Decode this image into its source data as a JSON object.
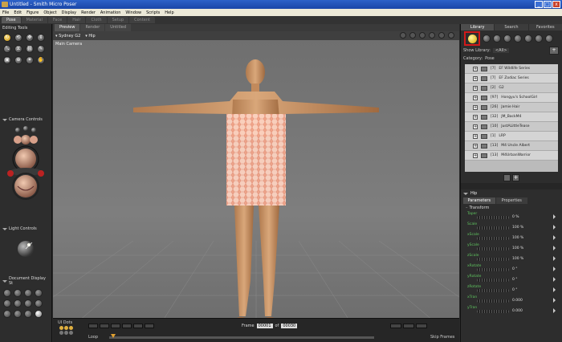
{
  "window": {
    "title": "Untitled - Smith Micro Poser"
  },
  "menu": [
    "File",
    "Edit",
    "Figure",
    "Object",
    "Display",
    "Render",
    "Animation",
    "Window",
    "Scripts",
    "Help"
  ],
  "room_tabs": [
    {
      "label": "Pose",
      "active": true
    },
    {
      "label": "Material",
      "active": false
    },
    {
      "label": "Face",
      "active": false
    },
    {
      "label": "Hair",
      "active": false
    },
    {
      "label": "Cloth",
      "active": false
    },
    {
      "label": "Setup",
      "active": false
    },
    {
      "label": "Content",
      "active": false
    }
  ],
  "left": {
    "editing_tools_title": "Editing Tools",
    "camera_controls_title": "Camera Controls",
    "light_controls_title": "Light Controls",
    "document_display_title": "Document Display St"
  },
  "viewport": {
    "tabs": [
      {
        "label": "Preview",
        "active": true
      },
      {
        "label": "Render",
        "active": false
      },
      {
        "label": "Untitled",
        "active": false
      }
    ],
    "figure_selector": "Sydney G2",
    "actor_selector": "Hip",
    "camera_label": "Main Camera"
  },
  "timeline": {
    "ui_dots_label": "UI Dots",
    "loop_label": "Loop",
    "frame_label": "Frame",
    "frame_value": "00001",
    "of_label": "of",
    "total_frames": "00030",
    "skip_frames_label": "Skip Frames"
  },
  "library": {
    "tabs": [
      {
        "label": "Library",
        "active": true
      },
      {
        "label": "Search",
        "active": false
      },
      {
        "label": "Favorites",
        "active": false
      }
    ],
    "show_library_label": "Show Library:",
    "show_library_value": "<All>",
    "category_label": "Category:",
    "category_value": "Pose",
    "items": [
      {
        "count": "[7]",
        "name": "EF Wildlife Series"
      },
      {
        "count": "[7]",
        "name": "EF Zodiac Series"
      },
      {
        "count": "[2]",
        "name": "G2"
      },
      {
        "count": "[97]",
        "name": "Hongyu's SchoolGirl"
      },
      {
        "count": "[26]",
        "name": "Jamie Hair"
      },
      {
        "count": "[32]",
        "name": "JM_BackM4"
      },
      {
        "count": "[10]",
        "name": "JustALittleTease"
      },
      {
        "count": "[1]",
        "name": "LRP"
      },
      {
        "count": "[13]",
        "name": "M4 Uncle Albert"
      },
      {
        "count": "[13]",
        "name": "M4UrbanWarrior"
      }
    ]
  },
  "parameters": {
    "actor": "Hip",
    "tabs": [
      {
        "label": "Parameters",
        "active": true
      },
      {
        "label": "Properties",
        "active": false
      }
    ],
    "group": "Transform",
    "rows": [
      {
        "label": "Taper",
        "value": "0 %"
      },
      {
        "label": "Scale",
        "value": "100 %"
      },
      {
        "label": "xScale",
        "value": "100 %"
      },
      {
        "label": "yScale",
        "value": "100 %"
      },
      {
        "label": "zScale",
        "value": "100 %"
      },
      {
        "label": "xRotate",
        "value": "0 °"
      },
      {
        "label": "yRotate",
        "value": "0 °"
      },
      {
        "label": "zRotate",
        "value": "0 °"
      },
      {
        "label": "xTran",
        "value": "0.000"
      },
      {
        "label": "yTran",
        "value": "0.000"
      }
    ]
  },
  "colors": {
    "titlebar": "#1f4fb8",
    "selected_highlight": "#d11a1a",
    "param_label": "#5fc45f"
  }
}
